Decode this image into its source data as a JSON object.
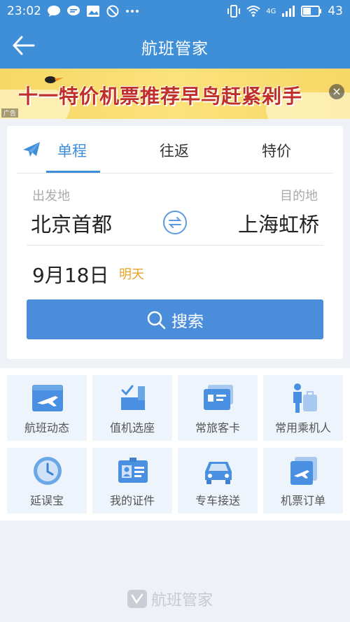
{
  "status_bar": {
    "time": "23:02",
    "network": "4G",
    "battery": "43"
  },
  "header": {
    "title": "航班管家"
  },
  "banner": {
    "slogan": "十一特价机票推荐早鸟赶紧剁手",
    "ad_label": "广告",
    "close_glyph": "×"
  },
  "search": {
    "tabs": [
      {
        "label": "单程"
      },
      {
        "label": "往返"
      },
      {
        "label": "特价"
      }
    ],
    "from_label": "出发地",
    "to_label": "目的地",
    "from_city": "北京首都",
    "to_city": "上海虹桥",
    "date": "9月18日",
    "date_tag": "明天",
    "button_label": "搜索"
  },
  "services": [
    {
      "label": "航班动态",
      "icon": "flight-status-icon"
    },
    {
      "label": "值机选座",
      "icon": "seat-checkin-icon"
    },
    {
      "label": "常旅客卡",
      "icon": "frequent-flyer-card-icon"
    },
    {
      "label": "常用乘机人",
      "icon": "passenger-icon"
    },
    {
      "label": "延误宝",
      "icon": "clock-icon"
    },
    {
      "label": "我的证件",
      "icon": "id-card-icon"
    },
    {
      "label": "专车接送",
      "icon": "car-icon"
    },
    {
      "label": "机票订单",
      "icon": "ticket-order-icon"
    }
  ],
  "footer": {
    "brand": "航班管家"
  },
  "colors": {
    "primary": "#3f8ed8",
    "accent": "#e9a227",
    "banner": "#f7d766"
  }
}
